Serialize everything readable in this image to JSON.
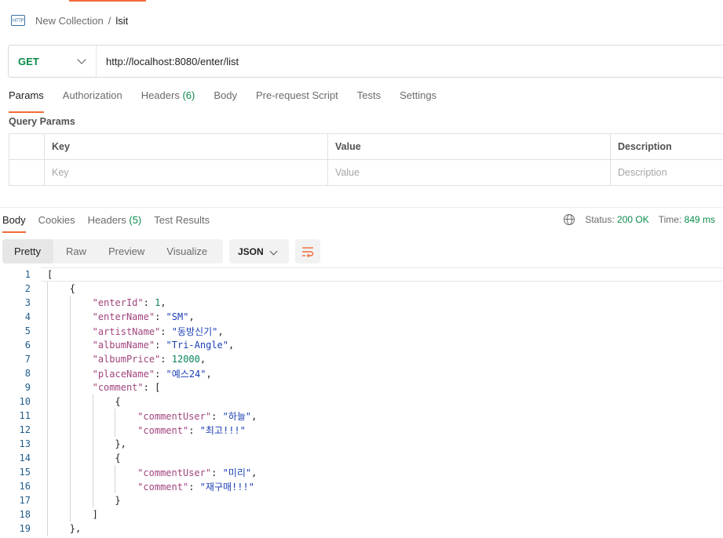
{
  "breadcrumb": {
    "icon": "http-icon",
    "icon_text": "HTTP",
    "collection": "New Collection",
    "separator": "/",
    "request": "lsit"
  },
  "request": {
    "method": "GET",
    "url": "http://localhost:8080/enter/list"
  },
  "request_tabs": [
    {
      "label": "Params",
      "count": ""
    },
    {
      "label": "Authorization",
      "count": ""
    },
    {
      "label": "Headers",
      "count": "(6)"
    },
    {
      "label": "Body",
      "count": ""
    },
    {
      "label": "Pre-request Script",
      "count": ""
    },
    {
      "label": "Tests",
      "count": ""
    },
    {
      "label": "Settings",
      "count": ""
    }
  ],
  "query_params": {
    "title": "Query Params",
    "headers": [
      "Key",
      "Value",
      "Description"
    ],
    "placeholders": [
      "Key",
      "Value",
      "Description"
    ]
  },
  "response_tabs": [
    {
      "label": "Body",
      "count": ""
    },
    {
      "label": "Cookies",
      "count": ""
    },
    {
      "label": "Headers",
      "count": "(5)"
    },
    {
      "label": "Test Results",
      "count": ""
    }
  ],
  "status": {
    "status_label": "Status:",
    "status_value": "200 OK",
    "time_label": "Time:",
    "time_value": "849 ms"
  },
  "view_modes": [
    "Pretty",
    "Raw",
    "Preview",
    "Visualize"
  ],
  "format": "JSON",
  "colors": {
    "accent": "#f26b3a",
    "method_get": "#0b8a4b",
    "json_key": "#a1457e",
    "json_string": "#1a3fb4",
    "json_number": "#098658"
  },
  "code_lines": [
    {
      "n": "1",
      "indent": 0,
      "parts": [
        [
          "p",
          "["
        ]
      ]
    },
    {
      "n": "2",
      "indent": 1,
      "parts": [
        [
          "p",
          "{"
        ]
      ]
    },
    {
      "n": "3",
      "indent": 2,
      "parts": [
        [
          "k",
          "\"enterId\""
        ],
        [
          "p",
          ": "
        ],
        [
          "n",
          "1"
        ],
        [
          "p",
          ","
        ]
      ]
    },
    {
      "n": "4",
      "indent": 2,
      "parts": [
        [
          "k",
          "\"enterName\""
        ],
        [
          "p",
          ": "
        ],
        [
          "s",
          "\"SM\""
        ],
        [
          "p",
          ","
        ]
      ]
    },
    {
      "n": "5",
      "indent": 2,
      "parts": [
        [
          "k",
          "\"artistName\""
        ],
        [
          "p",
          ": "
        ],
        [
          "s",
          "\"동방신기\""
        ],
        [
          "p",
          ","
        ]
      ]
    },
    {
      "n": "6",
      "indent": 2,
      "parts": [
        [
          "k",
          "\"albumName\""
        ],
        [
          "p",
          ": "
        ],
        [
          "s",
          "\"Tri-Angle\""
        ],
        [
          "p",
          ","
        ]
      ]
    },
    {
      "n": "7",
      "indent": 2,
      "parts": [
        [
          "k",
          "\"albumPrice\""
        ],
        [
          "p",
          ": "
        ],
        [
          "n",
          "12000"
        ],
        [
          "p",
          ","
        ]
      ]
    },
    {
      "n": "8",
      "indent": 2,
      "parts": [
        [
          "k",
          "\"placeName\""
        ],
        [
          "p",
          ": "
        ],
        [
          "s",
          "\"예스24\""
        ],
        [
          "p",
          ","
        ]
      ]
    },
    {
      "n": "9",
      "indent": 2,
      "parts": [
        [
          "k",
          "\"comment\""
        ],
        [
          "p",
          ": ["
        ]
      ]
    },
    {
      "n": "10",
      "indent": 3,
      "parts": [
        [
          "p",
          "{"
        ]
      ]
    },
    {
      "n": "11",
      "indent": 4,
      "parts": [
        [
          "k",
          "\"commentUser\""
        ],
        [
          "p",
          ": "
        ],
        [
          "s",
          "\"하늘\""
        ],
        [
          "p",
          ","
        ]
      ]
    },
    {
      "n": "12",
      "indent": 4,
      "parts": [
        [
          "k",
          "\"comment\""
        ],
        [
          "p",
          ": "
        ],
        [
          "s",
          "\"최고!!!\""
        ]
      ]
    },
    {
      "n": "13",
      "indent": 3,
      "parts": [
        [
          "p",
          "},"
        ]
      ]
    },
    {
      "n": "14",
      "indent": 3,
      "parts": [
        [
          "p",
          "{"
        ]
      ]
    },
    {
      "n": "15",
      "indent": 4,
      "parts": [
        [
          "k",
          "\"commentUser\""
        ],
        [
          "p",
          ": "
        ],
        [
          "s",
          "\"미리\""
        ],
        [
          "p",
          ","
        ]
      ]
    },
    {
      "n": "16",
      "indent": 4,
      "parts": [
        [
          "k",
          "\"comment\""
        ],
        [
          "p",
          ": "
        ],
        [
          "s",
          "\"재구매!!!\""
        ]
      ]
    },
    {
      "n": "17",
      "indent": 3,
      "parts": [
        [
          "p",
          "}"
        ]
      ]
    },
    {
      "n": "18",
      "indent": 2,
      "parts": [
        [
          "p",
          "]"
        ]
      ]
    },
    {
      "n": "19",
      "indent": 1,
      "parts": [
        [
          "p",
          "},"
        ]
      ]
    }
  ]
}
